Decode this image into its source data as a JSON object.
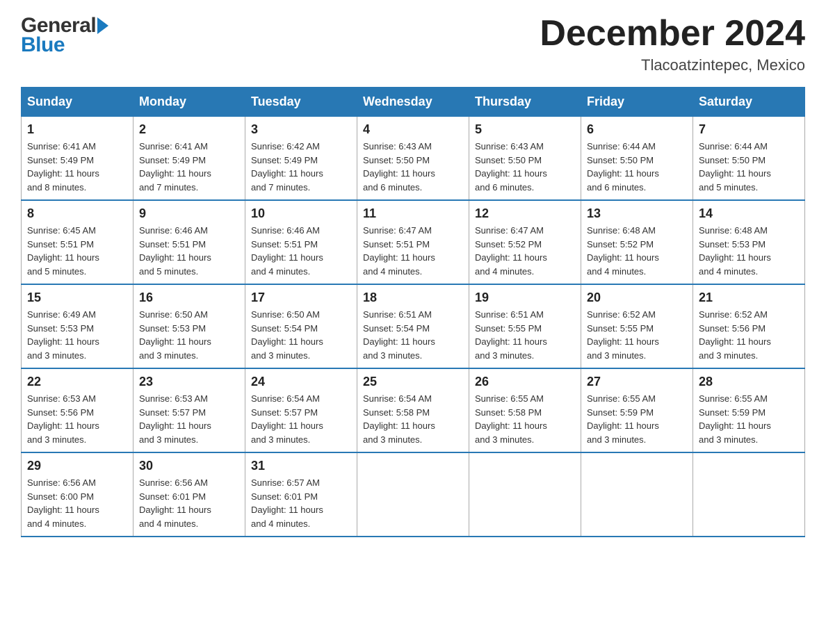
{
  "header": {
    "logo_general": "General",
    "logo_blue": "Blue",
    "month_title": "December 2024",
    "location": "Tlacoatzintepec, Mexico"
  },
  "weekdays": [
    "Sunday",
    "Monday",
    "Tuesday",
    "Wednesday",
    "Thursday",
    "Friday",
    "Saturday"
  ],
  "weeks": [
    [
      {
        "day": "1",
        "sunrise": "6:41 AM",
        "sunset": "5:49 PM",
        "daylight": "11 hours and 8 minutes."
      },
      {
        "day": "2",
        "sunrise": "6:41 AM",
        "sunset": "5:49 PM",
        "daylight": "11 hours and 7 minutes."
      },
      {
        "day": "3",
        "sunrise": "6:42 AM",
        "sunset": "5:49 PM",
        "daylight": "11 hours and 7 minutes."
      },
      {
        "day": "4",
        "sunrise": "6:43 AM",
        "sunset": "5:50 PM",
        "daylight": "11 hours and 6 minutes."
      },
      {
        "day": "5",
        "sunrise": "6:43 AM",
        "sunset": "5:50 PM",
        "daylight": "11 hours and 6 minutes."
      },
      {
        "day": "6",
        "sunrise": "6:44 AM",
        "sunset": "5:50 PM",
        "daylight": "11 hours and 6 minutes."
      },
      {
        "day": "7",
        "sunrise": "6:44 AM",
        "sunset": "5:50 PM",
        "daylight": "11 hours and 5 minutes."
      }
    ],
    [
      {
        "day": "8",
        "sunrise": "6:45 AM",
        "sunset": "5:51 PM",
        "daylight": "11 hours and 5 minutes."
      },
      {
        "day": "9",
        "sunrise": "6:46 AM",
        "sunset": "5:51 PM",
        "daylight": "11 hours and 5 minutes."
      },
      {
        "day": "10",
        "sunrise": "6:46 AM",
        "sunset": "5:51 PM",
        "daylight": "11 hours and 4 minutes."
      },
      {
        "day": "11",
        "sunrise": "6:47 AM",
        "sunset": "5:51 PM",
        "daylight": "11 hours and 4 minutes."
      },
      {
        "day": "12",
        "sunrise": "6:47 AM",
        "sunset": "5:52 PM",
        "daylight": "11 hours and 4 minutes."
      },
      {
        "day": "13",
        "sunrise": "6:48 AM",
        "sunset": "5:52 PM",
        "daylight": "11 hours and 4 minutes."
      },
      {
        "day": "14",
        "sunrise": "6:48 AM",
        "sunset": "5:53 PM",
        "daylight": "11 hours and 4 minutes."
      }
    ],
    [
      {
        "day": "15",
        "sunrise": "6:49 AM",
        "sunset": "5:53 PM",
        "daylight": "11 hours and 3 minutes."
      },
      {
        "day": "16",
        "sunrise": "6:50 AM",
        "sunset": "5:53 PM",
        "daylight": "11 hours and 3 minutes."
      },
      {
        "day": "17",
        "sunrise": "6:50 AM",
        "sunset": "5:54 PM",
        "daylight": "11 hours and 3 minutes."
      },
      {
        "day": "18",
        "sunrise": "6:51 AM",
        "sunset": "5:54 PM",
        "daylight": "11 hours and 3 minutes."
      },
      {
        "day": "19",
        "sunrise": "6:51 AM",
        "sunset": "5:55 PM",
        "daylight": "11 hours and 3 minutes."
      },
      {
        "day": "20",
        "sunrise": "6:52 AM",
        "sunset": "5:55 PM",
        "daylight": "11 hours and 3 minutes."
      },
      {
        "day": "21",
        "sunrise": "6:52 AM",
        "sunset": "5:56 PM",
        "daylight": "11 hours and 3 minutes."
      }
    ],
    [
      {
        "day": "22",
        "sunrise": "6:53 AM",
        "sunset": "5:56 PM",
        "daylight": "11 hours and 3 minutes."
      },
      {
        "day": "23",
        "sunrise": "6:53 AM",
        "sunset": "5:57 PM",
        "daylight": "11 hours and 3 minutes."
      },
      {
        "day": "24",
        "sunrise": "6:54 AM",
        "sunset": "5:57 PM",
        "daylight": "11 hours and 3 minutes."
      },
      {
        "day": "25",
        "sunrise": "6:54 AM",
        "sunset": "5:58 PM",
        "daylight": "11 hours and 3 minutes."
      },
      {
        "day": "26",
        "sunrise": "6:55 AM",
        "sunset": "5:58 PM",
        "daylight": "11 hours and 3 minutes."
      },
      {
        "day": "27",
        "sunrise": "6:55 AM",
        "sunset": "5:59 PM",
        "daylight": "11 hours and 3 minutes."
      },
      {
        "day": "28",
        "sunrise": "6:55 AM",
        "sunset": "5:59 PM",
        "daylight": "11 hours and 3 minutes."
      }
    ],
    [
      {
        "day": "29",
        "sunrise": "6:56 AM",
        "sunset": "6:00 PM",
        "daylight": "11 hours and 4 minutes."
      },
      {
        "day": "30",
        "sunrise": "6:56 AM",
        "sunset": "6:01 PM",
        "daylight": "11 hours and 4 minutes."
      },
      {
        "day": "31",
        "sunrise": "6:57 AM",
        "sunset": "6:01 PM",
        "daylight": "11 hours and 4 minutes."
      },
      null,
      null,
      null,
      null
    ]
  ],
  "labels": {
    "sunrise": "Sunrise:",
    "sunset": "Sunset:",
    "daylight": "Daylight:"
  }
}
